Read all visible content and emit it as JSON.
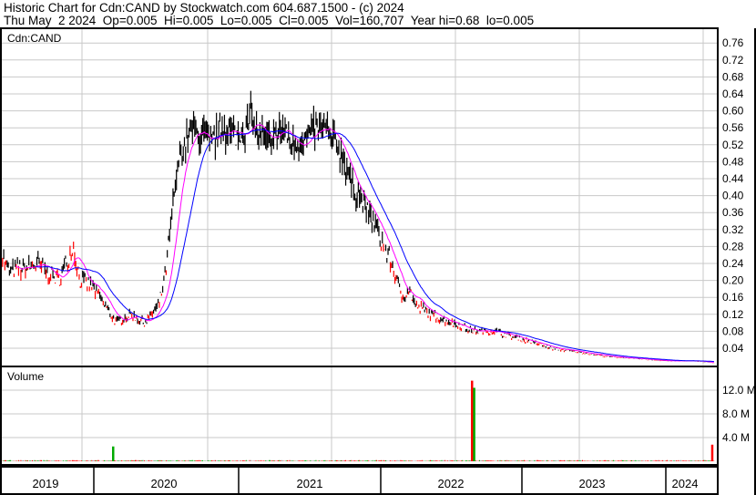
{
  "header": {
    "line1": "Historic Chart for Cdn:CAND by Stockwatch.com 604.687.1500 - (c) 2024",
    "line2": "Thu May  2 2024  Op=0.005  Hi=0.005  Lo=0.005  Cl=0.005  Vol=160,707  Year hi=0.68  lo=0.005"
  },
  "chart_data": {
    "type": "line",
    "title": "Cdn:CAND",
    "volume_label": "Volume",
    "price_ticks": [
      "0.04",
      "0.08",
      "0.12",
      "0.16",
      "0.20",
      "0.24",
      "0.28",
      "0.32",
      "0.36",
      "0.40",
      "0.44",
      "0.48",
      "0.52",
      "0.56",
      "0.60",
      "0.64",
      "0.68",
      "0.72",
      "0.76"
    ],
    "volume_ticks": [
      "4.0 M",
      "8.0 M",
      "12.0 M"
    ],
    "years": [
      "2019",
      "2020",
      "2021",
      "2022",
      "2023",
      "2024"
    ],
    "xlim": [
      2019.34,
      2024.36
    ],
    "ylim": [
      0,
      0.8
    ],
    "colors": {
      "bar": "#000000",
      "down": "#ff0000",
      "ma_short": "#ff00ff",
      "ma_long": "#0000ff",
      "vol_up": "#00aa00",
      "vol_down": "#ff0000",
      "grid": "#c8c8c8"
    },
    "price": [
      [
        2019.35,
        0.26
      ],
      [
        2019.4,
        0.22
      ],
      [
        2019.6,
        0.24
      ],
      [
        2019.75,
        0.2
      ],
      [
        2019.85,
        0.28
      ],
      [
        2019.9,
        0.2
      ],
      [
        2020.0,
        0.18
      ],
      [
        2020.15,
        0.1
      ],
      [
        2020.25,
        0.12
      ],
      [
        2020.35,
        0.1
      ],
      [
        2020.45,
        0.14
      ],
      [
        2020.5,
        0.22
      ],
      [
        2020.55,
        0.38
      ],
      [
        2020.6,
        0.5
      ],
      [
        2020.7,
        0.56
      ],
      [
        2020.8,
        0.52
      ],
      [
        2020.9,
        0.56
      ],
      [
        2021.0,
        0.54
      ],
      [
        2021.1,
        0.58
      ],
      [
        2021.2,
        0.52
      ],
      [
        2021.3,
        0.56
      ],
      [
        2021.4,
        0.52
      ],
      [
        2021.5,
        0.54
      ],
      [
        2021.6,
        0.56
      ],
      [
        2021.7,
        0.52
      ],
      [
        2021.75,
        0.48
      ],
      [
        2021.8,
        0.42
      ],
      [
        2021.85,
        0.4
      ],
      [
        2021.95,
        0.34
      ],
      [
        2022.05,
        0.26
      ],
      [
        2022.1,
        0.22
      ],
      [
        2022.15,
        0.16
      ],
      [
        2022.2,
        0.18
      ],
      [
        2022.25,
        0.14
      ],
      [
        2022.35,
        0.12
      ],
      [
        2022.5,
        0.1
      ],
      [
        2022.65,
        0.08
      ],
      [
        2022.8,
        0.08
      ],
      [
        2022.9,
        0.07
      ],
      [
        2023.0,
        0.06
      ],
      [
        2023.2,
        0.04
      ],
      [
        2023.4,
        0.03
      ],
      [
        2023.6,
        0.02
      ],
      [
        2023.8,
        0.015
      ],
      [
        2024.0,
        0.01
      ],
      [
        2024.2,
        0.01
      ],
      [
        2024.33,
        0.005
      ]
    ],
    "volume_spikes_millions": [
      [
        2020.13,
        2.5,
        "up"
      ],
      [
        2022.64,
        13.6,
        "down"
      ],
      [
        2022.655,
        12.4,
        "up"
      ],
      [
        2024.32,
        2.8,
        "down"
      ]
    ]
  }
}
